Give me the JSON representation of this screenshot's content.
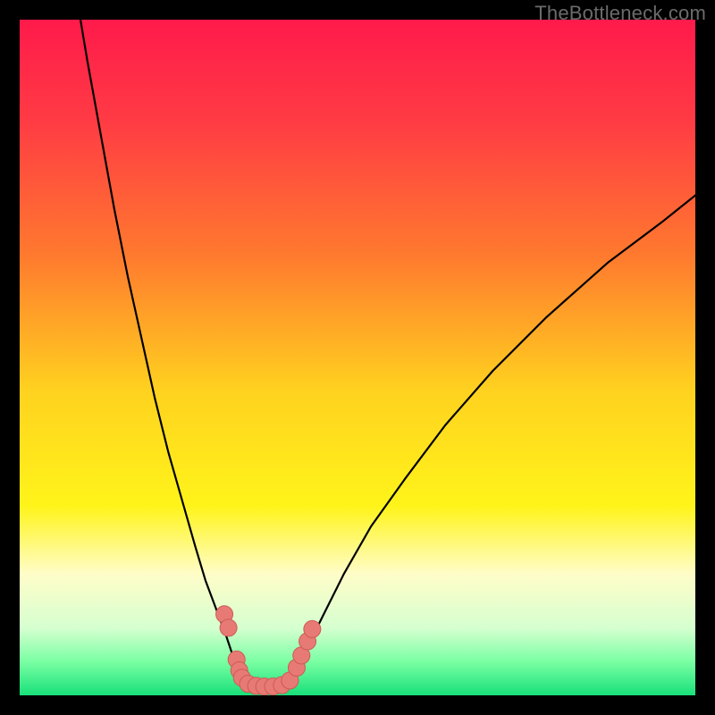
{
  "watermark": "TheBottleneck.com",
  "chart_data": {
    "type": "line",
    "title": "",
    "xlabel": "",
    "ylabel": "",
    "xlim": [
      0,
      100
    ],
    "ylim": [
      0,
      100
    ],
    "grid": false,
    "legend": false,
    "gradient_stops": [
      {
        "offset": 0.0,
        "color": "#ff1a4b"
      },
      {
        "offset": 0.15,
        "color": "#ff3b44"
      },
      {
        "offset": 0.35,
        "color": "#ff7a2e"
      },
      {
        "offset": 0.55,
        "color": "#ffd21f"
      },
      {
        "offset": 0.72,
        "color": "#fff41a"
      },
      {
        "offset": 0.82,
        "color": "#fffdc8"
      },
      {
        "offset": 0.9,
        "color": "#d6ffd0"
      },
      {
        "offset": 0.95,
        "color": "#7affa3"
      },
      {
        "offset": 1.0,
        "color": "#18e07a"
      }
    ],
    "series": [
      {
        "name": "left-curve",
        "x": [
          9,
          10,
          12,
          14,
          16,
          18,
          20,
          22,
          24,
          26,
          27.5,
          29,
          30.5,
          31.5,
          32.2,
          32.8
        ],
        "y": [
          100,
          94,
          83,
          72,
          62,
          53,
          44,
          36,
          29,
          22,
          17,
          13,
          9,
          6,
          3.2,
          1.6
        ]
      },
      {
        "name": "right-curve",
        "x": [
          40,
          41,
          42.5,
          45,
          48,
          52,
          57,
          63,
          70,
          78,
          87,
          95,
          100
        ],
        "y": [
          1.6,
          3.5,
          7,
          12,
          18,
          25,
          32,
          40,
          48,
          56,
          64,
          70,
          74
        ]
      },
      {
        "name": "bottom-plateau",
        "x": [
          32.8,
          34,
          36,
          38,
          40
        ],
        "y": [
          1.6,
          1.3,
          1.2,
          1.3,
          1.6
        ]
      }
    ],
    "markers": [
      {
        "x": 30.3,
        "y": 12.0
      },
      {
        "x": 30.9,
        "y": 10.0
      },
      {
        "x": 32.1,
        "y": 5.3
      },
      {
        "x": 32.5,
        "y": 3.7
      },
      {
        "x": 32.9,
        "y": 2.6
      },
      {
        "x": 33.8,
        "y": 1.7
      },
      {
        "x": 35.0,
        "y": 1.4
      },
      {
        "x": 36.2,
        "y": 1.3
      },
      {
        "x": 37.5,
        "y": 1.3
      },
      {
        "x": 38.8,
        "y": 1.5
      },
      {
        "x": 40.0,
        "y": 2.2
      },
      {
        "x": 41.0,
        "y": 4.1
      },
      {
        "x": 41.7,
        "y": 5.9
      },
      {
        "x": 42.6,
        "y": 8.0
      },
      {
        "x": 43.3,
        "y": 9.8
      }
    ],
    "marker_style": {
      "r": 9.5,
      "fill": "#e77a74",
      "stroke": "#cf5a54",
      "stroke_width": 1
    },
    "curve_style": {
      "stroke": "#000000",
      "stroke_width": 2.2
    }
  }
}
